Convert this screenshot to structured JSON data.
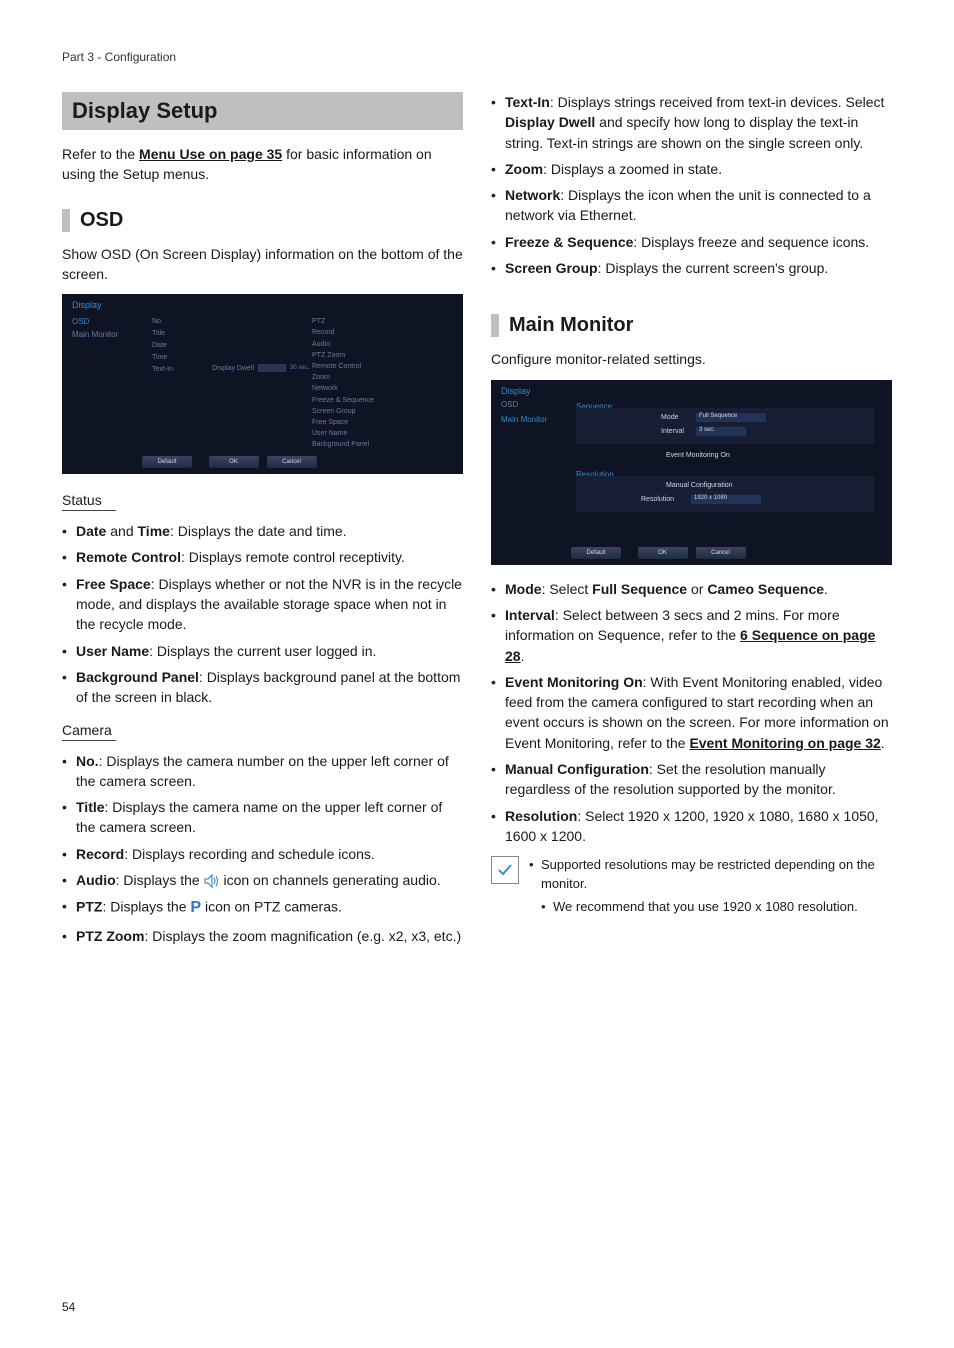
{
  "running_head": "Part 3 - Configuration",
  "page_number": "54",
  "left": {
    "display_setup_title": "Display Setup",
    "refer_pre": "Refer to the ",
    "refer_link": "Menu Use on page 35",
    "refer_post": " for basic information on using the Setup menus.",
    "osd_title": "OSD",
    "osd_intro": "Show OSD (On Screen Display) information on the bottom of the screen.",
    "osd_shot": {
      "tab": "Display",
      "side_active": "OSD",
      "side_dim": "Main Monitor",
      "col1": [
        "No.",
        "Title",
        "Date",
        "Time",
        "Text-In"
      ],
      "mid_label": "Display Dwell",
      "mid_val": "30  sec.",
      "col2": [
        "PTZ",
        "Record",
        "Audio",
        "PTZ Zoom",
        "Remote Control",
        "Zoom",
        "Network",
        "Freeze & Sequence",
        "Screen Group",
        "Free Space",
        "User Name",
        "Background Panel"
      ],
      "btn_default": "Default",
      "btn_ok": "OK",
      "btn_cancel": "Cancel"
    },
    "status_head": "Status",
    "status_items": [
      {
        "b": "Date",
        "mid": " and ",
        "b2": "Time",
        "rest": ": Displays the date and time."
      },
      {
        "b": "Remote Control",
        "rest": ": Displays remote control receptivity."
      },
      {
        "b": "Free Space",
        "rest": ": Displays whether or not the NVR is in the recycle mode, and displays the available storage space when not in the recycle mode."
      },
      {
        "b": "User Name",
        "rest": ": Displays the current user logged in."
      },
      {
        "b": "Background Panel",
        "rest": ": Displays background panel at the bottom of the screen in black."
      }
    ],
    "camera_head": "Camera",
    "camera_items": [
      {
        "b": "No.",
        "rest": ": Displays the camera number on the upper left corner of the camera screen."
      },
      {
        "b": "Title",
        "rest": ": Displays the camera name on the upper left corner of the camera screen."
      },
      {
        "b": "Record",
        "rest": ": Displays recording and schedule icons."
      },
      {
        "b": "Audio",
        "pre": ": Displays the ",
        "icon": "audio",
        "post": " icon on channels generating audio."
      },
      {
        "b": "PTZ",
        "pre": ": Displays the ",
        "icon": "ptz",
        "post": " icon on PTZ cameras."
      },
      {
        "b": "PTZ Zoom",
        "rest": ": Displays the zoom magnification (e.g. x2, x3, etc.)"
      }
    ]
  },
  "right": {
    "top_items": [
      {
        "b": "Text-In",
        "pre": ": Displays strings received from text-in devices. Select ",
        "b2": "Display Dwell",
        "post": " and specify how long to display the text-in string. Text-in strings are shown on the single screen only."
      },
      {
        "b": "Zoom",
        "rest": ": Displays a zoomed in state."
      },
      {
        "b": "Network",
        "rest": ": Displays the icon when the unit is connected to a network via Ethernet."
      },
      {
        "b": "Freeze & Sequence",
        "rest": ": Displays freeze and sequence icons."
      },
      {
        "b": "Screen Group",
        "rest": ": Displays the current screen's group."
      }
    ],
    "main_monitor_title": "Main Monitor",
    "main_monitor_intro": "Configure monitor-related settings.",
    "mm_shot": {
      "tab": "Display",
      "tab2": "OSD",
      "side_active": "Main Monitor",
      "grp1": "Sequence",
      "mode_label": "Mode",
      "mode_val": "Full Sequence",
      "int_label": "Interval",
      "int_val": "3 sec.",
      "evm": "Event Monitoring On",
      "grp2": "Resolution",
      "manconf": "Manual Configuration",
      "res_label": "Resolution",
      "res_val": "1920 x 1080",
      "btn_default": "Default",
      "btn_ok": "OK",
      "btn_cancel": "Cancel"
    },
    "mm_items": [
      {
        "b": "Mode",
        "pre": ": Select ",
        "b2": "Full Sequence",
        "mid": " or ",
        "b3": "Cameo Sequence",
        "post": "."
      },
      {
        "b": "Interval",
        "pre": ": Select between 3 secs and 2 mins. For more information on Sequence, refer to the ",
        "link": "6 Sequence on page 28",
        "post": "."
      },
      {
        "b": "Event Monitoring On",
        "pre": ": With Event Monitoring enabled, video feed from the camera configured to start recording when an event occurs is shown on the screen. For more information on Event Monitoring, refer to the ",
        "link": "Event Monitoring on page 32",
        "post": "."
      },
      {
        "b": "Manual Configuration",
        "rest": ": Set the resolution manually regardless of the resolution supported by the monitor."
      },
      {
        "b": "Resolution",
        "rest": ": Select 1920 x 1200, 1920 x 1080, 1680 x 1050, 1600 x 1200."
      }
    ],
    "note_items": [
      "Supported resolutions may be restricted depending on the monitor.",
      "We recommend that you use 1920 x 1080 resolution."
    ]
  }
}
